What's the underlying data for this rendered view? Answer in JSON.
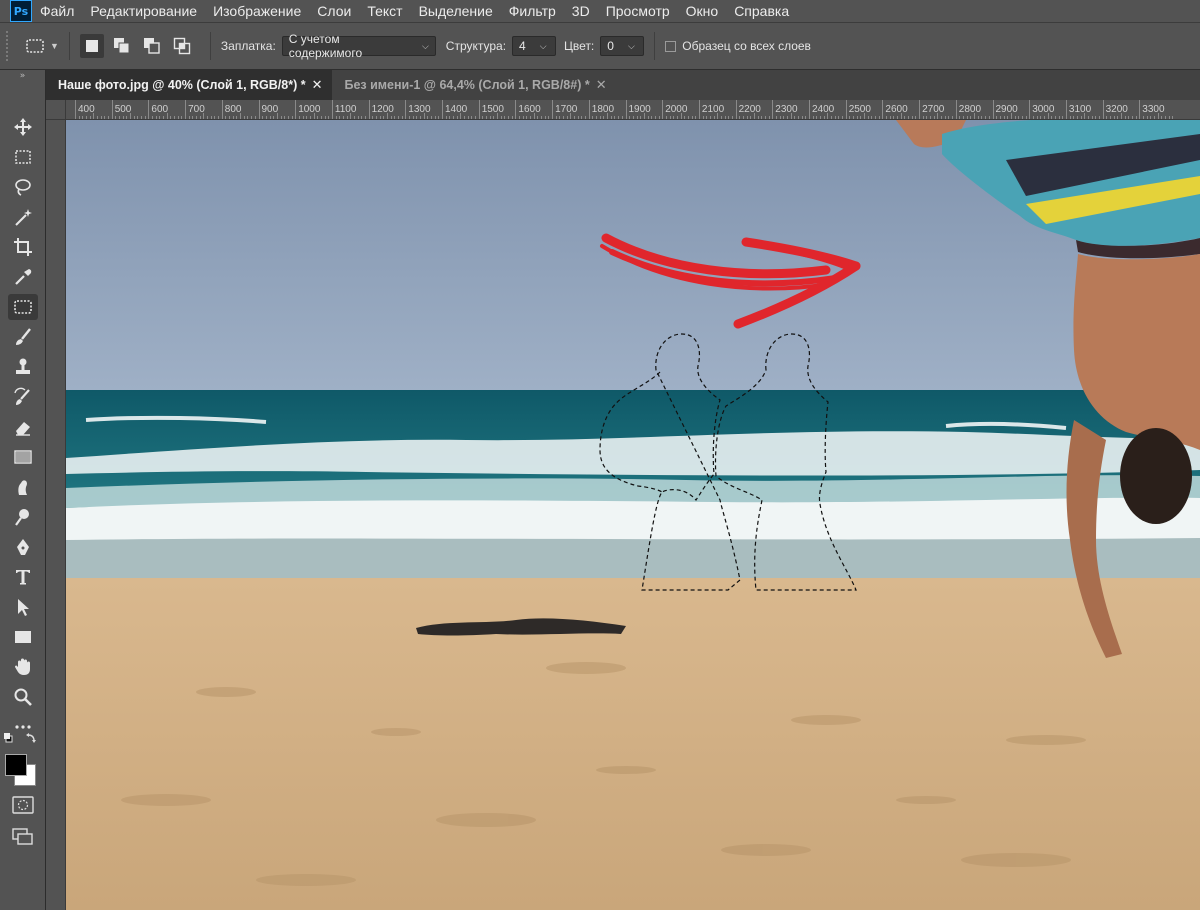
{
  "app": {
    "logo": "Ps",
    "menu": [
      "Файл",
      "Редактирование",
      "Изображение",
      "Слои",
      "Текст",
      "Выделение",
      "Фильтр",
      "3D",
      "Просмотр",
      "Окно",
      "Справка"
    ]
  },
  "options": {
    "patch_label": "Заплатка:",
    "patch_value": "С учетом содержимого",
    "structure_label": "Структура:",
    "structure_value": "4",
    "color_label": "Цвет:",
    "color_value": "0",
    "sample_all_layers": "Образец со всех слоев"
  },
  "tabs": [
    {
      "label": "Наше фото.jpg @ 40% (Слой 1, RGB/8*) *",
      "active": true
    },
    {
      "label": "Без имени-1 @ 64,4% (Слой 1, RGB/8#) *",
      "active": false
    }
  ],
  "ruler": {
    "ticks": [
      "400",
      "500",
      "600",
      "700",
      "800",
      "900",
      "1000",
      "1100",
      "1200",
      "1300",
      "1400",
      "1500",
      "1600",
      "1700",
      "1800",
      "1900",
      "2000",
      "2100",
      "2200",
      "2300",
      "2400",
      "2500",
      "2600",
      "2700",
      "2800",
      "2900",
      "3000",
      "3100",
      "3200",
      "3300"
    ]
  },
  "tools": [
    "move-tool-icon",
    "rectangular-marquee-icon",
    "lasso-icon",
    "magic-wand-icon",
    "crop-icon",
    "eyedropper-icon",
    "patch-tool-icon",
    "brush-icon",
    "clone-stamp-icon",
    "history-brush-icon",
    "eraser-icon",
    "gradient-icon",
    "smudge-icon",
    "dodge-icon",
    "pen-icon",
    "type-icon",
    "path-selection-icon",
    "rectangle-shape-icon",
    "hand-icon",
    "zoom-icon",
    "more-tools-icon"
  ],
  "colors": {
    "foreground": "#000000",
    "background": "#ffffff",
    "arrow": "#e0262c",
    "accent": "#31a8ff"
  }
}
